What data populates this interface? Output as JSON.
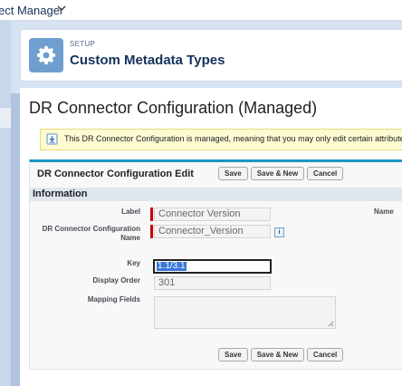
{
  "topbar": {
    "app_name": "ect Manager"
  },
  "setup": {
    "label": "SETUP",
    "title": "Custom Metadata Types"
  },
  "page": {
    "title": "DR Connector Configuration (Managed)"
  },
  "notice": {
    "text": "This DR Connector Configuration is managed, meaning that you may only edit certain attributes.",
    "link": "D"
  },
  "form": {
    "title": "DR Connector Configuration Edit",
    "buttons": {
      "save": "Save",
      "save_new": "Save & New",
      "cancel": "Cancel"
    },
    "section": "Information",
    "fields": {
      "label": {
        "label": "Label",
        "value": "Connector Version"
      },
      "name": {
        "label": "DR Connector Configuration Name",
        "value": "Connector_Version"
      },
      "right_label": "Name",
      "key": {
        "label": "Key",
        "value": "1.1/3.1"
      },
      "display_order": {
        "label": "Display Order",
        "value": "301"
      },
      "mapping_fields": {
        "label": "Mapping Fields",
        "value": ""
      }
    }
  },
  "icons": [
    "chevron-down-icon",
    "gear-icon",
    "info-icon",
    "notice-icon",
    "resize-handle-icon"
  ]
}
